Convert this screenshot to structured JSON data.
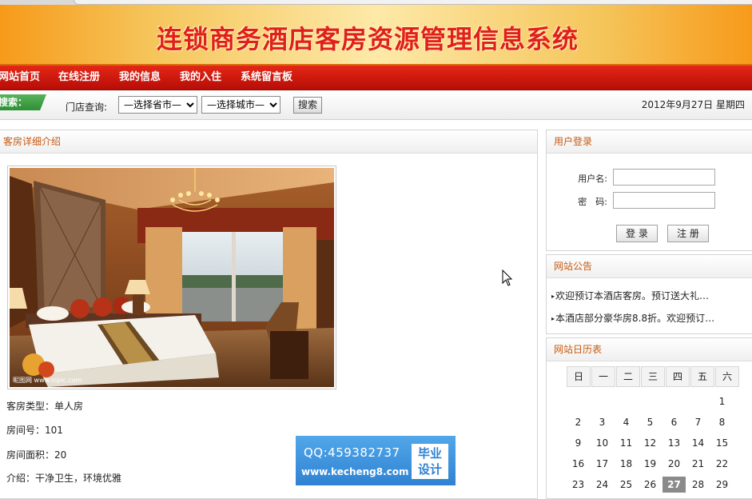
{
  "site": {
    "title": "连锁商务酒店客房资源管理信息系统"
  },
  "nav": {
    "items": [
      {
        "label": "网站首页"
      },
      {
        "label": "在线注册"
      },
      {
        "label": "我的信息"
      },
      {
        "label": "我的入住"
      },
      {
        "label": "系统留言板"
      }
    ]
  },
  "search": {
    "label": "搜索：",
    "store_label": "门店查询:",
    "province_selected": "—选择省市—",
    "city_selected": "—选择城市—",
    "button": "搜索",
    "date": "2012年9月27日 星期四"
  },
  "main": {
    "title": "客房详细介绍",
    "photo_alt": "客房照片",
    "room_type": "客房类型：单人房",
    "room_number": "房间号：101",
    "room_area": "房间面积：20",
    "intro": "介绍：干净卫生，环境优雅"
  },
  "login": {
    "title": "用户登录",
    "username_label": "用户名:",
    "password_label": "密　码:",
    "login_button": "登 录",
    "register_button": "注 册"
  },
  "notices": {
    "title": "网站公告",
    "items": [
      {
        "text": "欢迎预订本酒店客房。预订送大礼…"
      },
      {
        "text": "本酒店部分豪华房8.8折。欢迎预订…"
      }
    ]
  },
  "calendar": {
    "title": "网站日历表",
    "weekdays": [
      "日",
      "一",
      "二",
      "三",
      "四",
      "五",
      "六"
    ],
    "first_weekday": 6,
    "days_shown": 29,
    "today": 27
  },
  "qq_ad": {
    "qq": "QQ:459382737",
    "url": "www.kecheng8.com",
    "badge_line1": "毕业",
    "badge_line2": "设计"
  },
  "colors": {
    "accent": "#c55a11",
    "nav_red": "#d01a0e",
    "banner_title": "#e0201a"
  }
}
